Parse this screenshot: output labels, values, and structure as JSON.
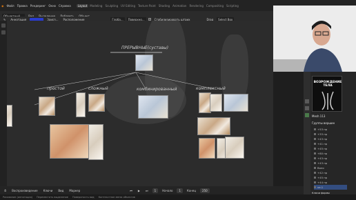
{
  "topbar": {
    "menu": [
      "Файл",
      "Правка",
      "Рендеринг",
      "Окно",
      "Справка"
    ],
    "tabs": [
      "Layout",
      "Modeling",
      "Sculpting",
      "UV Editing",
      "Texture Paint",
      "Shading",
      "Animation",
      "Rendering",
      "Compositing",
      "Scripting"
    ],
    "active_tab": "Layout"
  },
  "toolbar": {
    "mode": "Объектный ...",
    "view": "Вид",
    "select": "Выделение",
    "add": "Добавить",
    "object": "Объект",
    "annotation": "Аннотация",
    "placement": "Заисп...",
    "placement2": "Расположение",
    "global": "Глоба...",
    "overlay": "Поверхно...",
    "stabilize": "Стабилизировать штрих",
    "drag": "Drag",
    "select_box": "Select Box"
  },
  "canvas": {
    "root_label": "ПРЕРЫВНЫЕ(суставы)",
    "branches": [
      "простой",
      "сложный",
      "комбинированный",
      "комплексный"
    ]
  },
  "timeline": {
    "playback": "Воспроизведение",
    "keying": "Ключи",
    "view": "Вид",
    "marker": "Маркер",
    "current_frame": "1",
    "start_label": "Начало",
    "start": "1",
    "end_label": "Конец",
    "end": "250"
  },
  "statusbar": {
    "items": [
      "Рисование (аннотация)",
      "Переместить выделение",
      "Поверхность вид",
      "Контекстное меню объектов"
    ]
  },
  "rightpanel": {
    "promo_title": "ВОЗРОЖДЕНИЕ ТЕЛА",
    "mesh_label": "Mesh 113",
    "groups_label": "Группы вершин",
    "groups": [
      "+53 пр",
      "+33 пр",
      "+43 пр",
      "+41 пр",
      "+45 пр",
      "+80 пр",
      "+43 пр",
      "+43 пр",
      "Воло",
      "+42 пр",
      "+45 пр",
      "+44 пр",
      "ve.1"
    ],
    "shapes_label": "Ключи формы"
  },
  "colors": {
    "accent": "#2a3ccf",
    "selection": "#334d80",
    "panel": "#262626",
    "canvas": "#2c2c2c"
  }
}
